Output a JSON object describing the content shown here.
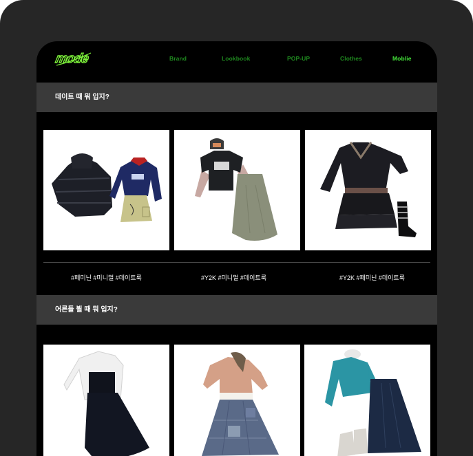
{
  "nav": {
    "logo_text": "mode",
    "links": [
      {
        "label": "Brand"
      },
      {
        "label": "Lookbook"
      },
      {
        "label": "POP-UP"
      },
      {
        "label": "Clothes"
      },
      {
        "label": "Moblie"
      }
    ]
  },
  "sections": [
    {
      "title": "데이트 때 뭐 입지?",
      "cards": [
        {
          "tags": "#페미닌 #미니멀 #데이트룩"
        },
        {
          "tags": "#Y2K #미니멀 #데이트룩"
        },
        {
          "tags": "#Y2K #페미닌 #데이트룩"
        }
      ]
    },
    {
      "title": "어른들 뵐 때 뭐 입지?"
    }
  ],
  "colors": {
    "frame": "#262626",
    "screen": "#000000",
    "header_bar": "#3a3a3a",
    "nav_link": "#1f8a1f",
    "nav_active": "#44e53a",
    "logo": "#7cf03a"
  }
}
